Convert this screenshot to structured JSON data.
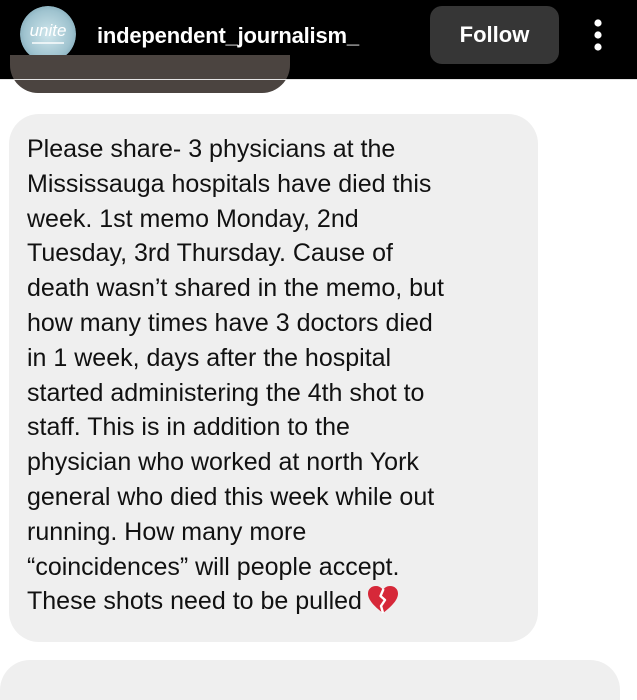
{
  "header": {
    "username": "independent_journalism_",
    "follow_label": "Follow",
    "avatar_text": "unite",
    "more_icon": "more-vertical-icon"
  },
  "message": {
    "text": "Please share- 3 physicians at the\nMississauga hospitals have died this\nweek. 1st memo Monday, 2nd\nTuesday, 3rd Thursday. Cause of\ndeath wasn’t shared in the memo, but\nhow many times have 3 doctors died\nin 1 week, days after the hospital\nstarted administering the 4th shot to\nstaff. This is in addition to the\nphysician who worked at north York\ngeneral who died this week while out\nrunning. How many more\n“coincidences” will people accept.\nThese shots need to be pulled",
    "emoji": "broken-heart-icon"
  },
  "colors": {
    "header_bg": "#000000",
    "follow_bg": "#363636",
    "bubble_bg": "#efefef",
    "text": "#111111",
    "heart": "#d62839"
  }
}
